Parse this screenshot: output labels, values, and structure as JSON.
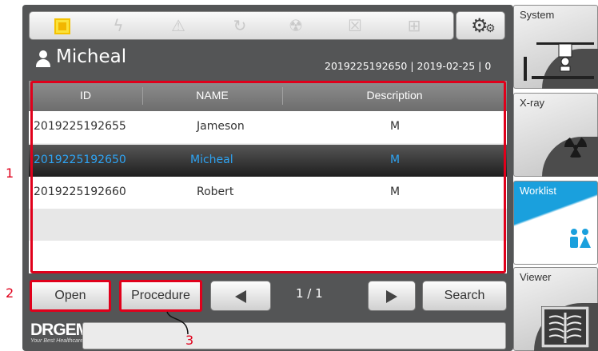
{
  "patient": {
    "name": "Micheal",
    "info": "2019225192650 | 2019-02-25 | 0"
  },
  "status_icons": [
    "exposure-ready-icon",
    "power-icon",
    "warning-icon",
    "refresh-icon",
    "tube-icon",
    "collimator-icon",
    "detector-icon"
  ],
  "table": {
    "columns": [
      "ID",
      "NAME",
      "Description"
    ],
    "rows": [
      {
        "id": "2019225192655",
        "name": "Jameson",
        "description": "M",
        "selected": false
      },
      {
        "id": "2019225192650",
        "name": "Micheal",
        "description": "M",
        "selected": true
      },
      {
        "id": "2019225192660",
        "name": "Robert",
        "description": "M",
        "selected": false
      }
    ]
  },
  "buttons": {
    "open": "Open",
    "procedure": "Procedure",
    "search": "Search"
  },
  "pagination": "1 / 1",
  "logo": {
    "main": "DRGEM",
    "sub": "Your Best Healthcare"
  },
  "side_tabs": [
    {
      "label": "System",
      "active": false
    },
    {
      "label": "X-ray",
      "active": false
    },
    {
      "label": "Worklist",
      "active": true
    },
    {
      "label": "Viewer",
      "active": false
    }
  ],
  "annotations": [
    "1",
    "2",
    "3"
  ],
  "colors": {
    "panel": "#545556",
    "accent": "#1aa0dd",
    "selected_text": "#2ea3f2",
    "highlight": "#e0001b"
  }
}
